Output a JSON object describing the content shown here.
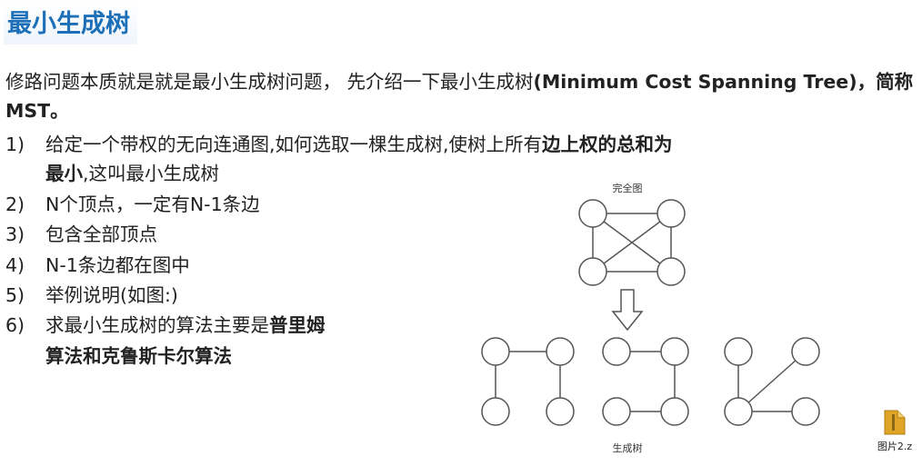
{
  "title": "最小生成树",
  "intro": {
    "part1": "修路问题本质就是就是最小生成树问题， 先介绍一下最小生成树",
    "part2_bold": "(Minimum Cost Spanning Tree)，简称MST。"
  },
  "items": [
    {
      "num": "1)",
      "text": "给定一个带权的无向连通图,如何选取一棵生成树,使树上所有",
      "bold": "边上权的总和为",
      "line2_bold": "最小",
      "line2_rest": ",这叫最小生成树"
    },
    {
      "num": "2)",
      "text": "N个顶点，一定有N-1条边"
    },
    {
      "num": "3)",
      "text": "包含全部顶点"
    },
    {
      "num": "4)",
      "text": "N-1条边都在图中"
    },
    {
      "num": "5)",
      "text": "举例说明(如图:)"
    },
    {
      "num": "6)",
      "text": "求最小生成树的算法主要是",
      "bold": "普里姆",
      "line2_bold": "算法和克鲁斯卡尔算法"
    }
  ],
  "diagram": {
    "top_label": "完全图",
    "bottom_label": "生成树"
  },
  "file_icon": {
    "label": "图片2.z",
    "icon": "folder-zip-icon",
    "color": "#e0a526"
  },
  "colors": {
    "title": "#1d6fb8",
    "node_stroke": "#555555"
  }
}
